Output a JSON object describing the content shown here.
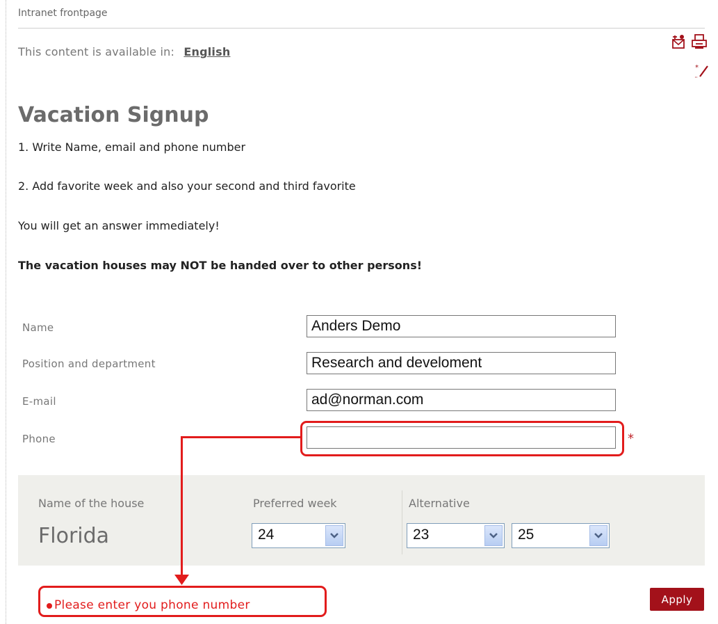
{
  "breadcrumb": "Intranet frontpage",
  "language": {
    "prefix": "This content is available in:",
    "link": "English"
  },
  "icons": [
    "email-page-icon",
    "print-icon",
    "edit-icon"
  ],
  "title": "Vacation Signup",
  "instructions": [
    "1. Write Name, email and phone number",
    "2. Add favorite week and also your second and third favorite",
    "You will get an answer immediately!",
    "The vacation houses may NOT be handed over to other persons!"
  ],
  "form": {
    "name": {
      "label": "Name",
      "value": "Anders Demo"
    },
    "position": {
      "label": "Position and department",
      "value": "Research and develoment"
    },
    "email": {
      "label": "E-mail",
      "value": "ad@norman.com"
    },
    "phone": {
      "label": "Phone",
      "value": "",
      "required_mark": "*"
    }
  },
  "house": {
    "name_label": "Name of the house",
    "name_value": "Florida",
    "preferred_label": "Preferred week",
    "preferred_value": "24",
    "alternative_label": "Alternative",
    "alternative_1": "23",
    "alternative_2": "25"
  },
  "error": "Please enter you phone number",
  "apply_label": "Apply",
  "colors": {
    "accent_red": "#a3111a",
    "annotation_red": "#e21c1c",
    "panel_bg": "#efefeb"
  }
}
